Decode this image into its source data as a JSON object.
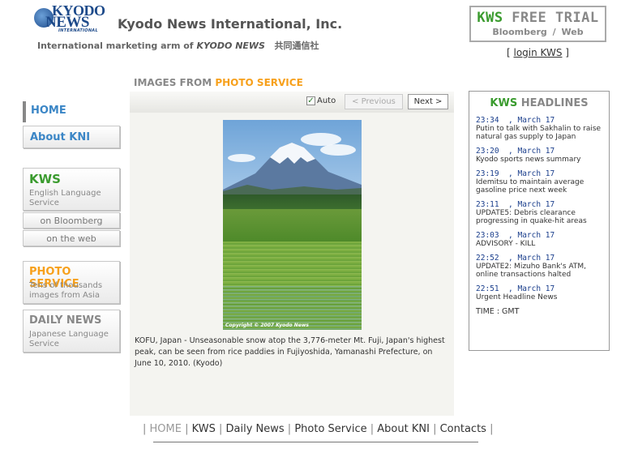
{
  "logo": {
    "line1": "KYODO",
    "line2": "NEWS",
    "line3": "INTERNATIONAL"
  },
  "header": {
    "title": "Kyodo News International, Inc.",
    "tagline_prefix": "International marketing arm of ",
    "tagline_em": "KYODO NEWS",
    "tagline_jp": "共同通信社"
  },
  "trial": {
    "kws": "KWS",
    "rest": " FREE TRIAL",
    "sub1": "Bloomberg",
    "sub_sep": "/",
    "sub2": "Web"
  },
  "login": {
    "open": "[ ",
    "label": "login KWS",
    "close": " ]"
  },
  "section": {
    "prefix": "IMAGES FROM ",
    "highlight": "PHOTO SERVICE"
  },
  "nav": {
    "home": "HOME",
    "kni": "About KNI",
    "kws_title": "KWS",
    "kws_desc": "English Language Service",
    "kws_bloomberg": "on Bloomberg",
    "kws_web": "on the web",
    "photo_title": "PHOTO SERVICE",
    "photo_desc": "Tens of thousands images from Asia",
    "daily_title": "DAILY NEWS",
    "daily_desc": "Japanese Language Service"
  },
  "viewer": {
    "auto_label": "Auto",
    "auto_checked": true,
    "prev_label": "< Previous",
    "next_label": "Next >",
    "copyright": "Copyright © 2007 Kyodo News",
    "caption": "KOFU, Japan - Unseasonable snow atop the 3,776-meter Mt. Fuji, Japan's highest peak, can be seen from rice paddies in Fujiyoshida, Yamanashi Prefecture, on June 10, 2010. (Kyodo)"
  },
  "headlines": {
    "title_kws": "KWS",
    "title_rest": " HEADLINES",
    "items": [
      {
        "time": "23:34  , March 17",
        "text": "Putin to talk with Sakhalin to raise natural gas supply to Japan"
      },
      {
        "time": "23:20  , March 17",
        "text": "Kyodo sports news summary"
      },
      {
        "time": "23:19  , March 17",
        "text": "Idemitsu to maintain average gasoline price next week"
      },
      {
        "time": "23:11  , March 17",
        "text": "UPDATE5: Debris clearance progressing in quake-hit areas"
      },
      {
        "time": "23:03  , March 17",
        "text": "ADVISORY - KILL"
      },
      {
        "time": "22:52  , March 17",
        "text": "UPDATE2: Mizuho Bank's ATM, online transactions halted"
      },
      {
        "time": "22:51  , March 17",
        "text": "Urgent Headline News"
      }
    ],
    "timezone": "TIME : GMT"
  },
  "footer": {
    "sep": "|",
    "links": [
      "HOME",
      "KWS",
      "Daily News",
      "Photo Service",
      "About KNI",
      "Contacts"
    ]
  },
  "colors": {
    "kws_green": "#3a9b2e",
    "photo_orange": "#f7a01b",
    "link_blue": "#3b86c6",
    "time_blue": "#1a3e8c"
  }
}
